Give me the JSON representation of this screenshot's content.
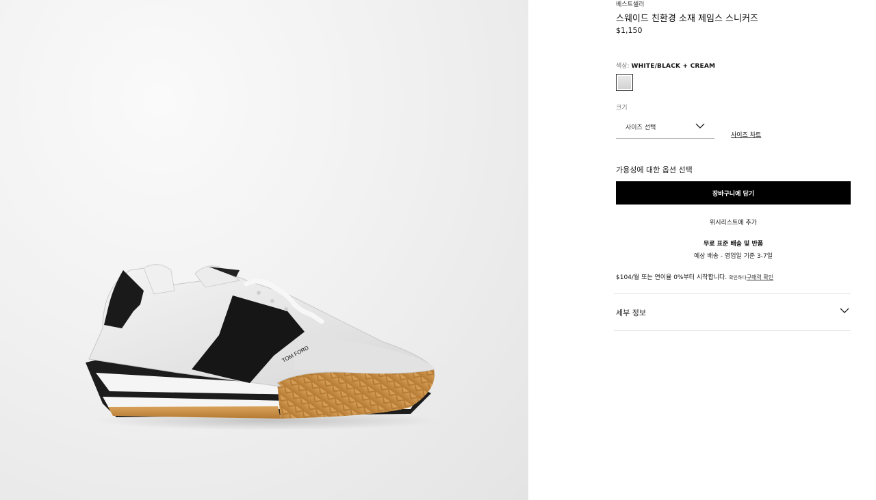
{
  "product": {
    "eyebrow": "베스트셀러",
    "title": "스웨이드 친환경 소재 제임스 스니커즈",
    "price": "$1,150",
    "image_alt": "TOM FORD",
    "logo_text": "TOM FORD"
  },
  "color": {
    "label": "색상: ",
    "value": "WHITE/BLACK + CREAM"
  },
  "size": {
    "label": "크기",
    "select_placeholder": "사이즈 선택",
    "chart_link": "사이즈 차트"
  },
  "availability_text": "가용성에 대한 옵션 선택",
  "cart_button": "장바구니에 담기",
  "wishlist_button": "위시리스트에 추가",
  "shipping": {
    "title": "무료 표준 배송 및 반품",
    "subtitle": "예상 배송 - 영업일 기준 3-7일"
  },
  "installment": {
    "text": "$104/월 또는 연이율 0%부터 시작합니다.",
    "small": "확인하다",
    "link": "구매력 확인"
  },
  "details_accordion": "세부 정보"
}
